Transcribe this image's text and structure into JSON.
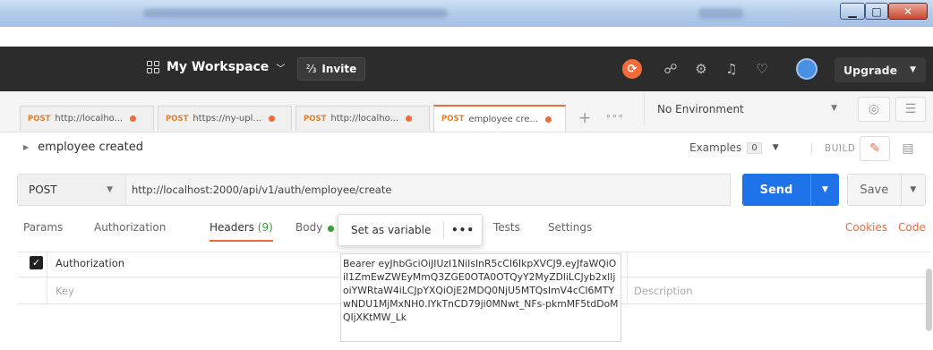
{
  "window": {
    "minimize_glyph": "▁",
    "maximize_glyph": "□",
    "close_glyph": "✕"
  },
  "header": {
    "workspace_label": "My Workspace",
    "invite_label": "Invite",
    "upgrade_label": "Upgrade",
    "icons": [
      "sync-icon",
      "satellite-icon",
      "settings-icon",
      "bell-icon",
      "heart-icon",
      "avatar"
    ]
  },
  "tabs": [
    {
      "method": "POST",
      "title": "http://localho...",
      "active": false
    },
    {
      "method": "POST",
      "title": "https://ny-upl...",
      "active": false
    },
    {
      "method": "POST",
      "title": "http://localho...",
      "active": false
    },
    {
      "method": "POST",
      "title": "employee cre...",
      "active": true
    }
  ],
  "tab_controls": {
    "add": "+",
    "more": "∘∘∘"
  },
  "environment": {
    "selected": "No Environment"
  },
  "request": {
    "name": "employee created",
    "examples_label": "Examples",
    "examples_count": "0",
    "build_label": "BUILD",
    "method": "POST",
    "url": "http://localhost:2000/api/v1/auth/employee/create",
    "send_label": "Send",
    "save_label": "Save"
  },
  "request_tabs": {
    "params": "Params",
    "authorization": "Authorization",
    "headers": "Headers",
    "headers_count": "(9)",
    "body": "Body",
    "tests": "Tests",
    "settings": "Settings",
    "cookies": "Cookies",
    "code": "Code"
  },
  "popover": {
    "set_as_variable": "Set as variable",
    "more": "•••"
  },
  "headers_table": {
    "rows": [
      {
        "checked": true,
        "key": "Authorization",
        "value": "Bearer eyJhbGciOiJIUzI1NiIsInR5cCI6IkpXVCJ9.eyJfaWQiOiI1ZmEwZWEyMmQ3ZGE0OTA0OTQyY2MyZDliLCJyb2xlIjoiYWRtaW4iLCJpYXQiOjE2MDQ0NjU5MTQsImV4cCI6MTYwNDU1MjMxNH0.IYkTnCD79ji0MNwt_NFs-pkmMF5tdDoMQIjXKtMW_Lk"
      }
    ],
    "key_placeholder": "Key",
    "description_placeholder": "Description"
  },
  "colors": {
    "accent": "#f26b3a",
    "send": "#1e73e8",
    "header_bg": "#2c2c2c"
  }
}
